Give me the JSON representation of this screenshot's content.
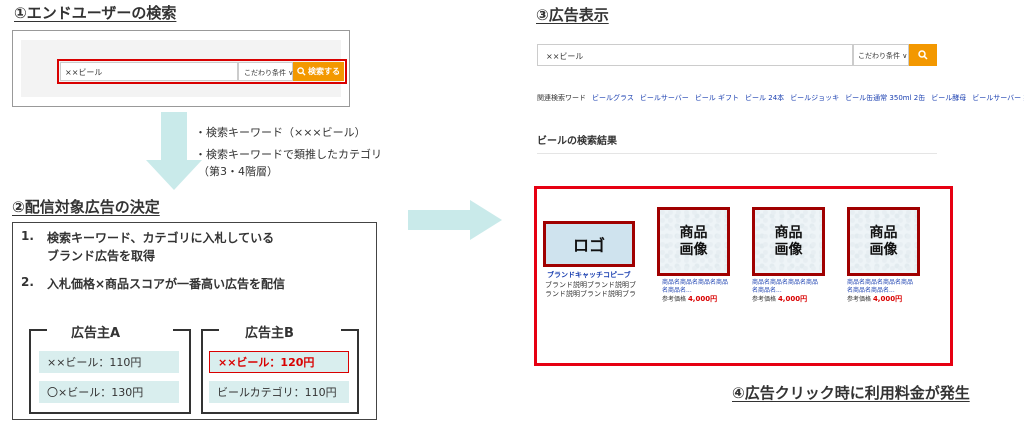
{
  "step1": {
    "title": "①エンドユーザーの検索",
    "search_value": "××ビール",
    "condition_label": "こだわり条件 ∨",
    "search_button": "検索する"
  },
  "notes": {
    "line1": "・検索キーワード（×××ビール）",
    "line2": "・検索キーワードで類推したカテゴリ",
    "line3": "（第3・4階層）"
  },
  "step2": {
    "title": "②配信対象広告の決定",
    "item1_num": "1.",
    "item1_line1": "検索キーワード、カテゴリに入札している",
    "item1_line2": "ブランド広告を取得",
    "item2_num": "2.",
    "item2": "入札価格×商品スコアが一番高い広告を配信",
    "advertiserA": {
      "title": "広告主A",
      "row1": "××ビール：110円",
      "row2": "〇×ビール：130円"
    },
    "advertiserB": {
      "title": "広告主B",
      "row1": "××ビール：120円",
      "row2": "ビールカテゴリ：110円"
    }
  },
  "step3": {
    "title": "③広告表示",
    "search_value": "××ビール",
    "condition_label": "こだわり条件 ∨",
    "related_label": "関連検索ワード",
    "related": [
      "ビールグラス",
      "ビールサーバー",
      "ビール ギフト",
      "ビール 24本",
      "ビールジョッキ",
      "ビール缶通常 350ml 2缶",
      "ビール酵母",
      "ビールサーバー 業務用"
    ],
    "results_title": "ビールの検索結果",
    "ad": {
      "logo": "ロゴ",
      "catch": "ブランドキャッチコピーブ",
      "desc_line1": "ブランド説明ブランド説明ブ",
      "desc_line2": "ランド説明ブランド説明ブラ",
      "products": [
        {
          "image_label_1": "商品",
          "image_label_2": "画像",
          "name1": "商品名商品名商品名商品",
          "name2": "名商品名...",
          "price_label": "参考価格",
          "price": "4,000円"
        },
        {
          "image_label_1": "商品",
          "image_label_2": "画像",
          "name1": "商品名商品名商品名商品",
          "name2": "名商品名...",
          "price_label": "参考価格",
          "price": "4,000円"
        },
        {
          "image_label_1": "商品",
          "image_label_2": "画像",
          "name1": "商品名商品名商品名商品",
          "name2": "名商品名商品名...",
          "price_label": "参考価格",
          "price": "4,000円"
        }
      ]
    }
  },
  "step4": {
    "title": "④広告クリック時に利用料金が発生"
  },
  "colors": {
    "accent": "#f39800",
    "highlight": "#d90000",
    "arrow": "#c9eaea",
    "teal_box": "#d9eeee"
  }
}
